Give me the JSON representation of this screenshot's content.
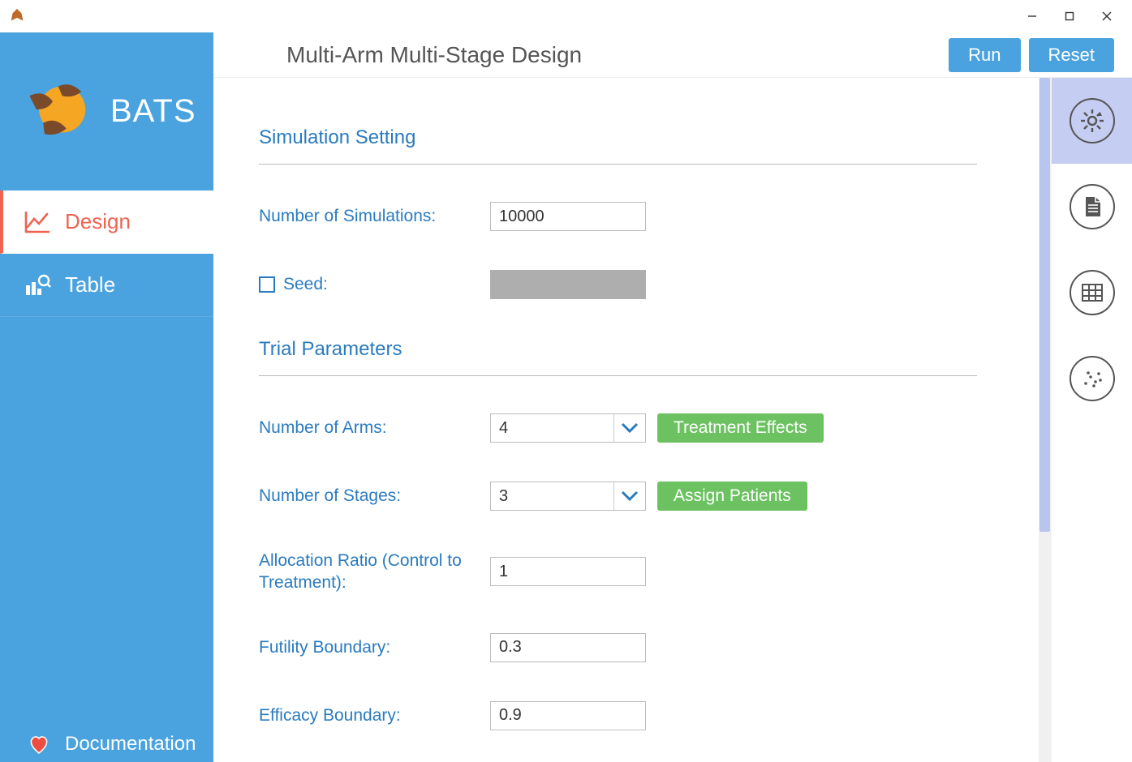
{
  "app": {
    "name": "BATS"
  },
  "window_controls": {
    "minimize": "–",
    "maximize": "□",
    "close": "×"
  },
  "sidebar": {
    "items": [
      {
        "label": "Design",
        "icon": "chart-line"
      },
      {
        "label": "Table",
        "icon": "table-search"
      }
    ],
    "footer": {
      "label": "Documentation",
      "icon": "heart"
    }
  },
  "header": {
    "title": "Multi-Arm Multi-Stage Design",
    "run_label": "Run",
    "reset_label": "Reset"
  },
  "sections": {
    "simulation": {
      "title": "Simulation Setting"
    },
    "trial": {
      "title": "Trial Parameters"
    }
  },
  "form": {
    "n_sim_label": "Number of Simulations:",
    "n_sim_value": "10000",
    "seed_label": "Seed:",
    "seed_value": "",
    "n_arms_label": "Number of Arms:",
    "n_arms_value": "4",
    "treatment_effects_btn": "Treatment Effects",
    "n_stages_label": "Number of Stages:",
    "n_stages_value": "3",
    "assign_patients_btn": "Assign Patients",
    "alloc_ratio_label": "Allocation Ratio (Control to Treatment):",
    "alloc_ratio_value": "1",
    "futility_label": "Futility Boundary:",
    "futility_value": "0.3",
    "efficacy_label": "Efficacy Boundary:",
    "efficacy_value": "0.9"
  },
  "rail": {
    "items": [
      {
        "name": "settings"
      },
      {
        "name": "document"
      },
      {
        "name": "table"
      },
      {
        "name": "scatter"
      }
    ]
  }
}
